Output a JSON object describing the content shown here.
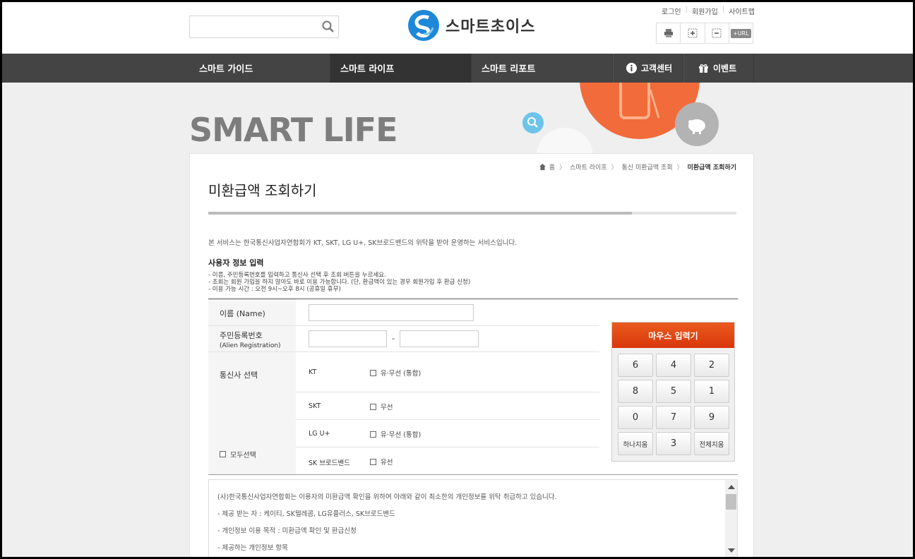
{
  "search": {
    "placeholder": ""
  },
  "logo": {
    "text": "스마트초이스"
  },
  "util": {
    "login": "로그인",
    "join": "회원가입",
    "sitemap": "사이트맵"
  },
  "tools": [
    "print-icon",
    "zoom-in-icon",
    "zoom-out-icon",
    "url-copy-icon"
  ],
  "tool_url_label": "+URL",
  "nav": {
    "guide": "스마트 가이드",
    "life": "스마트 라이프",
    "report": "스마트 리포트",
    "support": "고객센터",
    "event": "이벤트"
  },
  "hero": {
    "title": "SMART LIFE"
  },
  "breadcrumb": {
    "home": "홈",
    "b1": "스마트 라이프",
    "b2": "통신 미환급액 조회",
    "current": "미환급액 조회하기"
  },
  "page": {
    "title": "미환급액 조회하기",
    "intro": "본 서비스는 한국통신사업자연합회가 KT, SKT, LG U+, SK브로드밴드의 위탁을 받아 운영하는 서비스입니다.",
    "section_title": "사용자 정보 입력",
    "notes": [
      "- 이름, 주민등록번호를 입력하고 통신사 선택 후 조회 버튼을 누르세요.",
      "- 조회는 회원 가입을 하지 않아도 바로 이용 가능합니다. (단, 환급액이 있는 경우 회원가입 후 환급 신청)",
      "- 이용 가능 시간 : 오전 9시~오후 8시 (공휴일 휴무)"
    ]
  },
  "form": {
    "name_label": "이름 (Name)",
    "rrn_label": "주민등록번호",
    "rrn_sub": "(Alien Registration)",
    "rrn_dash": "-",
    "carrier_label": "통신사 선택",
    "select_all": "모두선택",
    "carriers": [
      {
        "name": "KT",
        "option": "유·무선 (통합)"
      },
      {
        "name": "SKT",
        "option": "무선"
      },
      {
        "name": "LG U+",
        "option": "유·무선 (통합)"
      },
      {
        "name": "SK 브로드밴드",
        "option": "유선"
      }
    ]
  },
  "keypad": {
    "title": "마우스 입력기",
    "keys": [
      "6",
      "4",
      "2",
      "8",
      "5",
      "1",
      "0",
      "7",
      "9",
      "하나지움",
      "3",
      "전체지움"
    ]
  },
  "terms": [
    "(사)한국통신사업자연합회는 이용자의 미환급액 확인을 위하여 아래와 같이 최소한의 개인정보를 위탁 취급하고 있습니다.",
    "- 제공 받는 자 : 케이티, SK텔레콤, LG유플러스, SK브로드밴드",
    "- 개인정보 이용 목적 : 미환급액 확인 및 환급신청",
    "- 제공하는 개인정보 항목"
  ],
  "colors": {
    "nav_bg": "#444444",
    "accent_orange": "#e2400c",
    "hero_circle": "#f26b3a",
    "hero_blue": "#6ec3ea"
  }
}
